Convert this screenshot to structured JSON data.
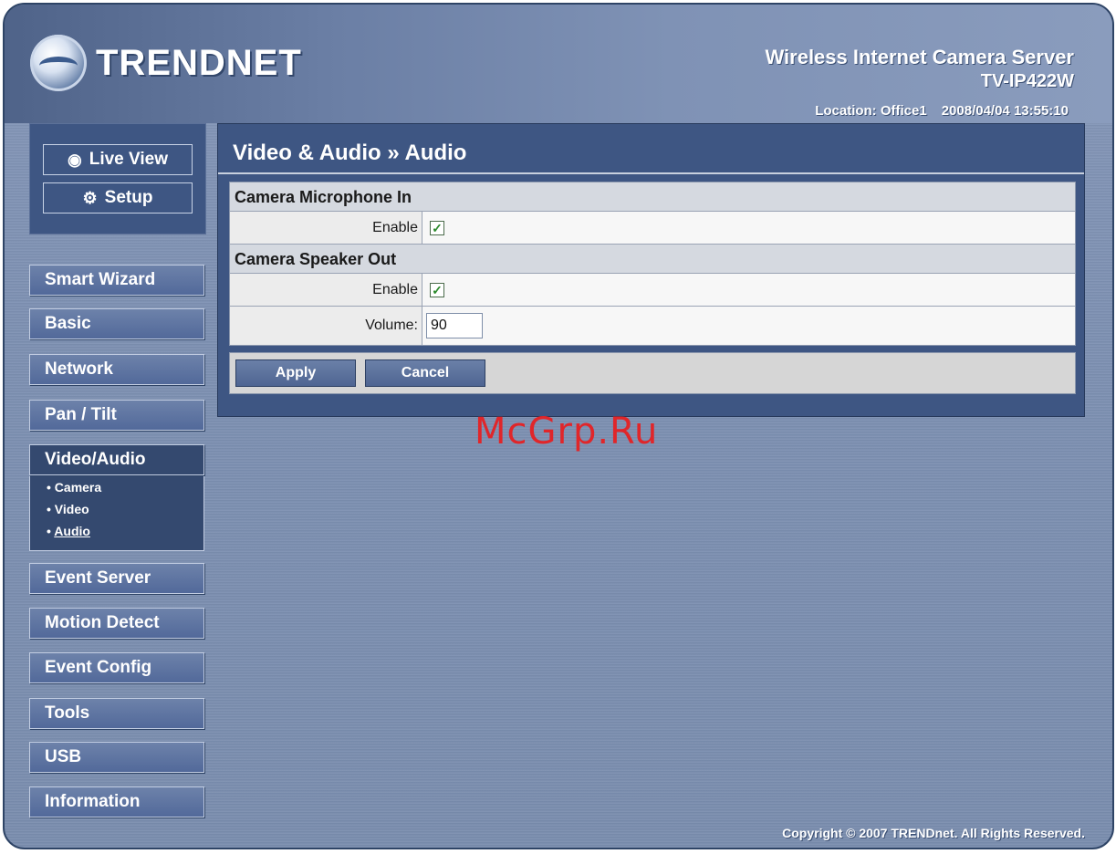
{
  "header": {
    "logo_text": "TRENDNET",
    "product_line1": "Wireless Internet Camera Server",
    "product_line2": "TV-IP422W",
    "location": "Location: Office1",
    "datetime": "2008/04/04 13:55:10"
  },
  "top_buttons": {
    "live_view": "Live View",
    "live_view_icon": "eye-icon",
    "setup": "Setup",
    "setup_icon": "gears-icon"
  },
  "nav": {
    "smart_wizard": "Smart Wizard",
    "basic": "Basic",
    "network": "Network",
    "pan_tilt": "Pan / Tilt",
    "video_audio": "Video/Audio",
    "sub_camera": "Camera",
    "sub_video": "Video",
    "sub_audio": "Audio",
    "event_server": "Event Server",
    "motion_detect": "Motion Detect",
    "event_config": "Event Config",
    "tools": "Tools",
    "usb": "USB",
    "information": "Information"
  },
  "panel": {
    "title": "Video & Audio » Audio",
    "mic_section": "Camera Microphone In",
    "mic_enable_label": "Enable",
    "mic_enabled": true,
    "speaker_section": "Camera Speaker Out",
    "speaker_enable_label": "Enable",
    "speaker_enabled": true,
    "volume_label": "Volume:",
    "volume_value": "90",
    "apply": "Apply",
    "cancel": "Cancel"
  },
  "watermark": "McGrp.Ru",
  "footer": {
    "copyright": "Copyright © 2007 TRENDnet. All Rights Reserved."
  },
  "colors": {
    "panel_bg": "#3e5683",
    "check": "#2c8a2c",
    "watermark": "#e0262a"
  }
}
